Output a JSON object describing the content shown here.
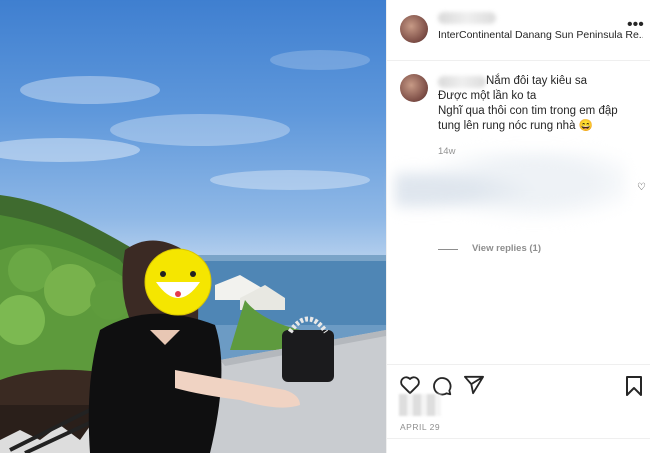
{
  "post": {
    "location": "InterContinental Danang Sun Peninsula Re...",
    "caption_lines": [
      "Nắm đôi tay kiêu sa",
      "Được một lần ko ta",
      "Nghĩ qua thôi con tim trong em đập",
      "tung lên rung nóc rung nhà 😄"
    ],
    "comment_age": "14w",
    "view_replies": "View replies (1)",
    "date": "APRIL 29"
  },
  "icons": {
    "more": "more-options-icon",
    "like": "heart-icon",
    "comment": "comment-icon",
    "share": "paper-plane-icon",
    "save": "bookmark-icon",
    "comment_like": "small-heart-icon"
  }
}
